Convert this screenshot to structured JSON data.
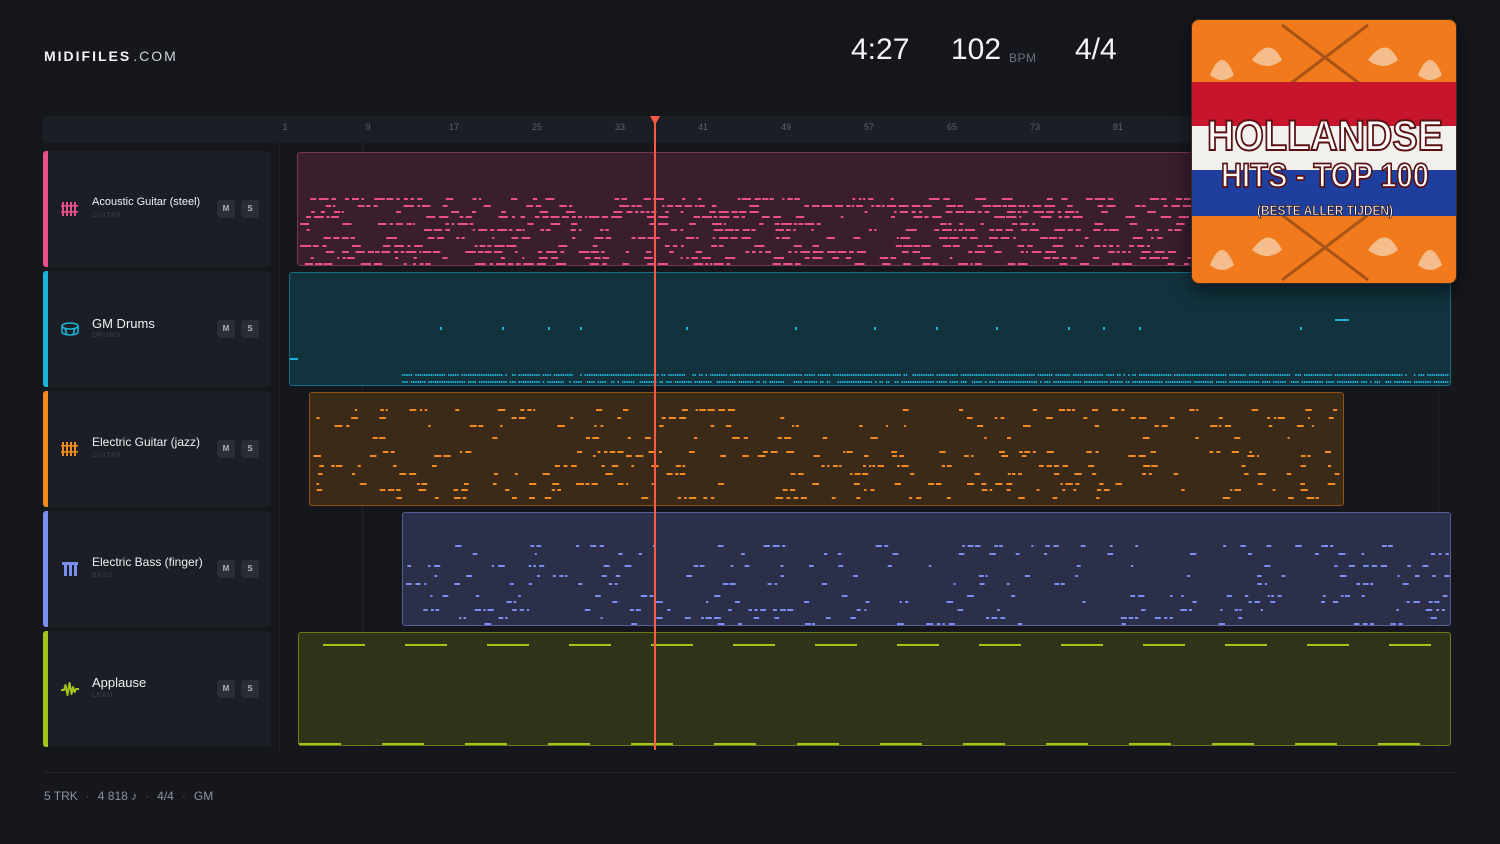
{
  "app": {
    "logo_bold": "MIDIFILES",
    "logo_light": ".COM"
  },
  "transport": {
    "time": "4:27",
    "tempo": "102",
    "tempo_unit": "BPM",
    "time_signature": "4/4"
  },
  "ruler": {
    "bars": [
      "1",
      "9",
      "17",
      "25",
      "33",
      "41",
      "49",
      "57",
      "65",
      "73",
      "81"
    ]
  },
  "playhead": {
    "bar": 36
  },
  "tracks": [
    {
      "name": "Acoustic Guitar (steel)",
      "category": "GUITAR",
      "color": "#e8508a",
      "icon": "guitar-icon",
      "mute_label": "M",
      "solo_label": "S"
    },
    {
      "name": "GM Drums",
      "category": "DRUMS",
      "color": "#1ab3d6",
      "icon": "drum-icon",
      "mute_label": "M",
      "solo_label": "S"
    },
    {
      "name": "Electric Guitar (jazz)",
      "category": "GUITAR",
      "color": "#f28a1d",
      "icon": "guitar-icon",
      "mute_label": "M",
      "solo_label": "S"
    },
    {
      "name": "Electric Bass (finger)",
      "category": "BASS",
      "color": "#7b8ef0",
      "icon": "bass-icon",
      "mute_label": "M",
      "solo_label": "S"
    },
    {
      "name": "Applause",
      "category": "LEAD",
      "color": "#a3c41b",
      "icon": "waveform-icon",
      "mute_label": "M",
      "solo_label": "S"
    }
  ],
  "cover": {
    "title": "HOLLANDSE",
    "subtitle": "HITS - TOP 100",
    "tagline": "(BESTE ALLER TIJDEN)"
  },
  "footer": {
    "tracks": "5 TRK",
    "notes": "4 818 ♪",
    "signature": "4/4",
    "standard": "GM"
  }
}
